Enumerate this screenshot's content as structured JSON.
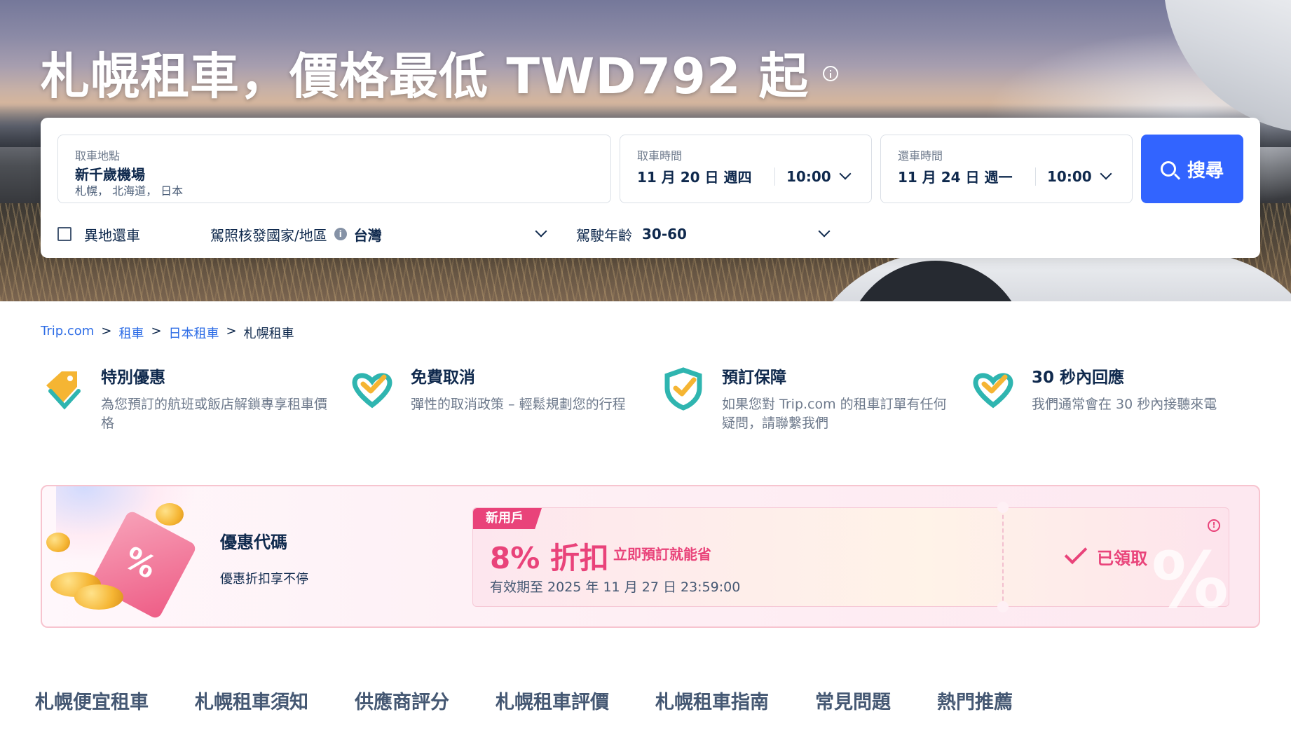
{
  "hero": {
    "title": "札幌租車，價格最低 TWD792 起"
  },
  "search": {
    "pickup_location": {
      "label": "取車地點",
      "value": "新千歲機場",
      "sub": "札幌， 北海道， 日本"
    },
    "pickup_time": {
      "label": "取車時間",
      "date": "11 月 20 日 週四",
      "time": "10:00"
    },
    "return_time": {
      "label": "還車時間",
      "date": "11 月 24 日 週一",
      "time": "10:00"
    },
    "search_button": "搜尋",
    "different_return": "異地還車",
    "license_label": "駕照核發國家/地區",
    "license_value": "台灣",
    "age_label": "駕駛年齡",
    "age_value": "30-60"
  },
  "breadcrumb": [
    {
      "label": "Trip.com",
      "link": true
    },
    {
      "label": "租車",
      "link": true
    },
    {
      "label": "日本租車",
      "link": true
    },
    {
      "label": "札幌租車",
      "link": false
    }
  ],
  "breadcrumb_separator": ">",
  "features": [
    {
      "title": "特別優惠",
      "desc": "為您預訂的航班或飯店解鎖專享租車價格",
      "icon": "tag-icon"
    },
    {
      "title": "免費取消",
      "desc": "彈性的取消政策 – 輕鬆規劃您的行程",
      "icon": "heart-check-icon"
    },
    {
      "title": "預訂保障",
      "desc": "如果您對 Trip.com 的租車訂單有任何疑問，請聯繫我們",
      "icon": "shield-check-icon"
    },
    {
      "title": "30 秒內回應",
      "desc": "我們通常會在 30 秒內接聽來電",
      "icon": "heart-check-icon"
    }
  ],
  "promo": {
    "title": "優惠代碼",
    "subtitle": "優惠折扣享不停",
    "coupon": {
      "tag": "新用戶",
      "amount": "8% 折扣",
      "note": "立即預訂就能省",
      "valid": "有效期至 2025 年 11 月 27 日 23:59:00",
      "status": "已領取"
    }
  },
  "tabs": [
    "札幌便宜租車",
    "札幌租車須知",
    "供應商評分",
    "札幌租車評價",
    "札幌租車指南",
    "常見問題",
    "熱門推薦"
  ],
  "colors": {
    "primary_blue": "#3264ff",
    "link_blue": "#2e6de6",
    "promo_pink": "#e9437a",
    "text_dark": "#0f294d"
  }
}
